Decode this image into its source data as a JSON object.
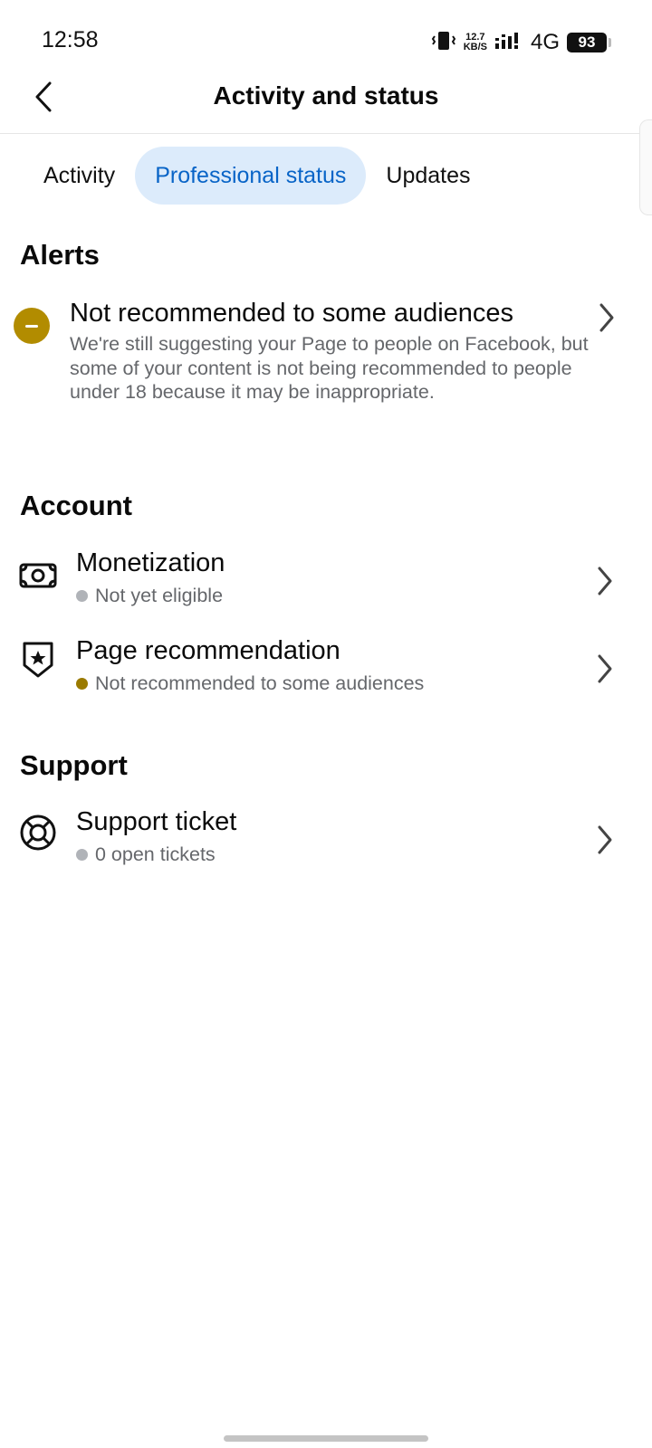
{
  "status_bar": {
    "time": "12:58",
    "speed_value": "12.7",
    "speed_unit": "KB/S",
    "network": "4G",
    "battery": "93"
  },
  "header": {
    "title": "Activity and status",
    "back_icon": "chevron-left-icon"
  },
  "tabs": [
    {
      "label": "Activity",
      "active": false
    },
    {
      "label": "Professional status",
      "active": true
    },
    {
      "label": "Updates",
      "active": false
    }
  ],
  "alerts": {
    "heading": "Alerts",
    "item": {
      "icon": "minus-circle-icon",
      "title": "Not recommended to some audiences",
      "description": "We're still suggesting your Page to people on Facebook, but some of your content is not being recommended to people under 18 because it may be inappropriate."
    }
  },
  "account": {
    "heading": "Account",
    "items": [
      {
        "icon": "money-icon",
        "title": "Monetization",
        "status": "Not yet eligible",
        "status_color": "#b0b3b8"
      },
      {
        "icon": "shield-star-icon",
        "title": "Page recommendation",
        "status": "Not recommended to some audiences",
        "status_color": "#9a7a00"
      }
    ]
  },
  "support": {
    "heading": "Support",
    "items": [
      {
        "icon": "lifebuoy-icon",
        "title": "Support ticket",
        "status": "0 open tickets",
        "status_color": "#b0b3b8"
      }
    ]
  },
  "colors": {
    "accent": "#0864c7",
    "active_tab_bg": "#dcebfb",
    "warning": "#b28c00",
    "secondary_text": "#65676b"
  }
}
